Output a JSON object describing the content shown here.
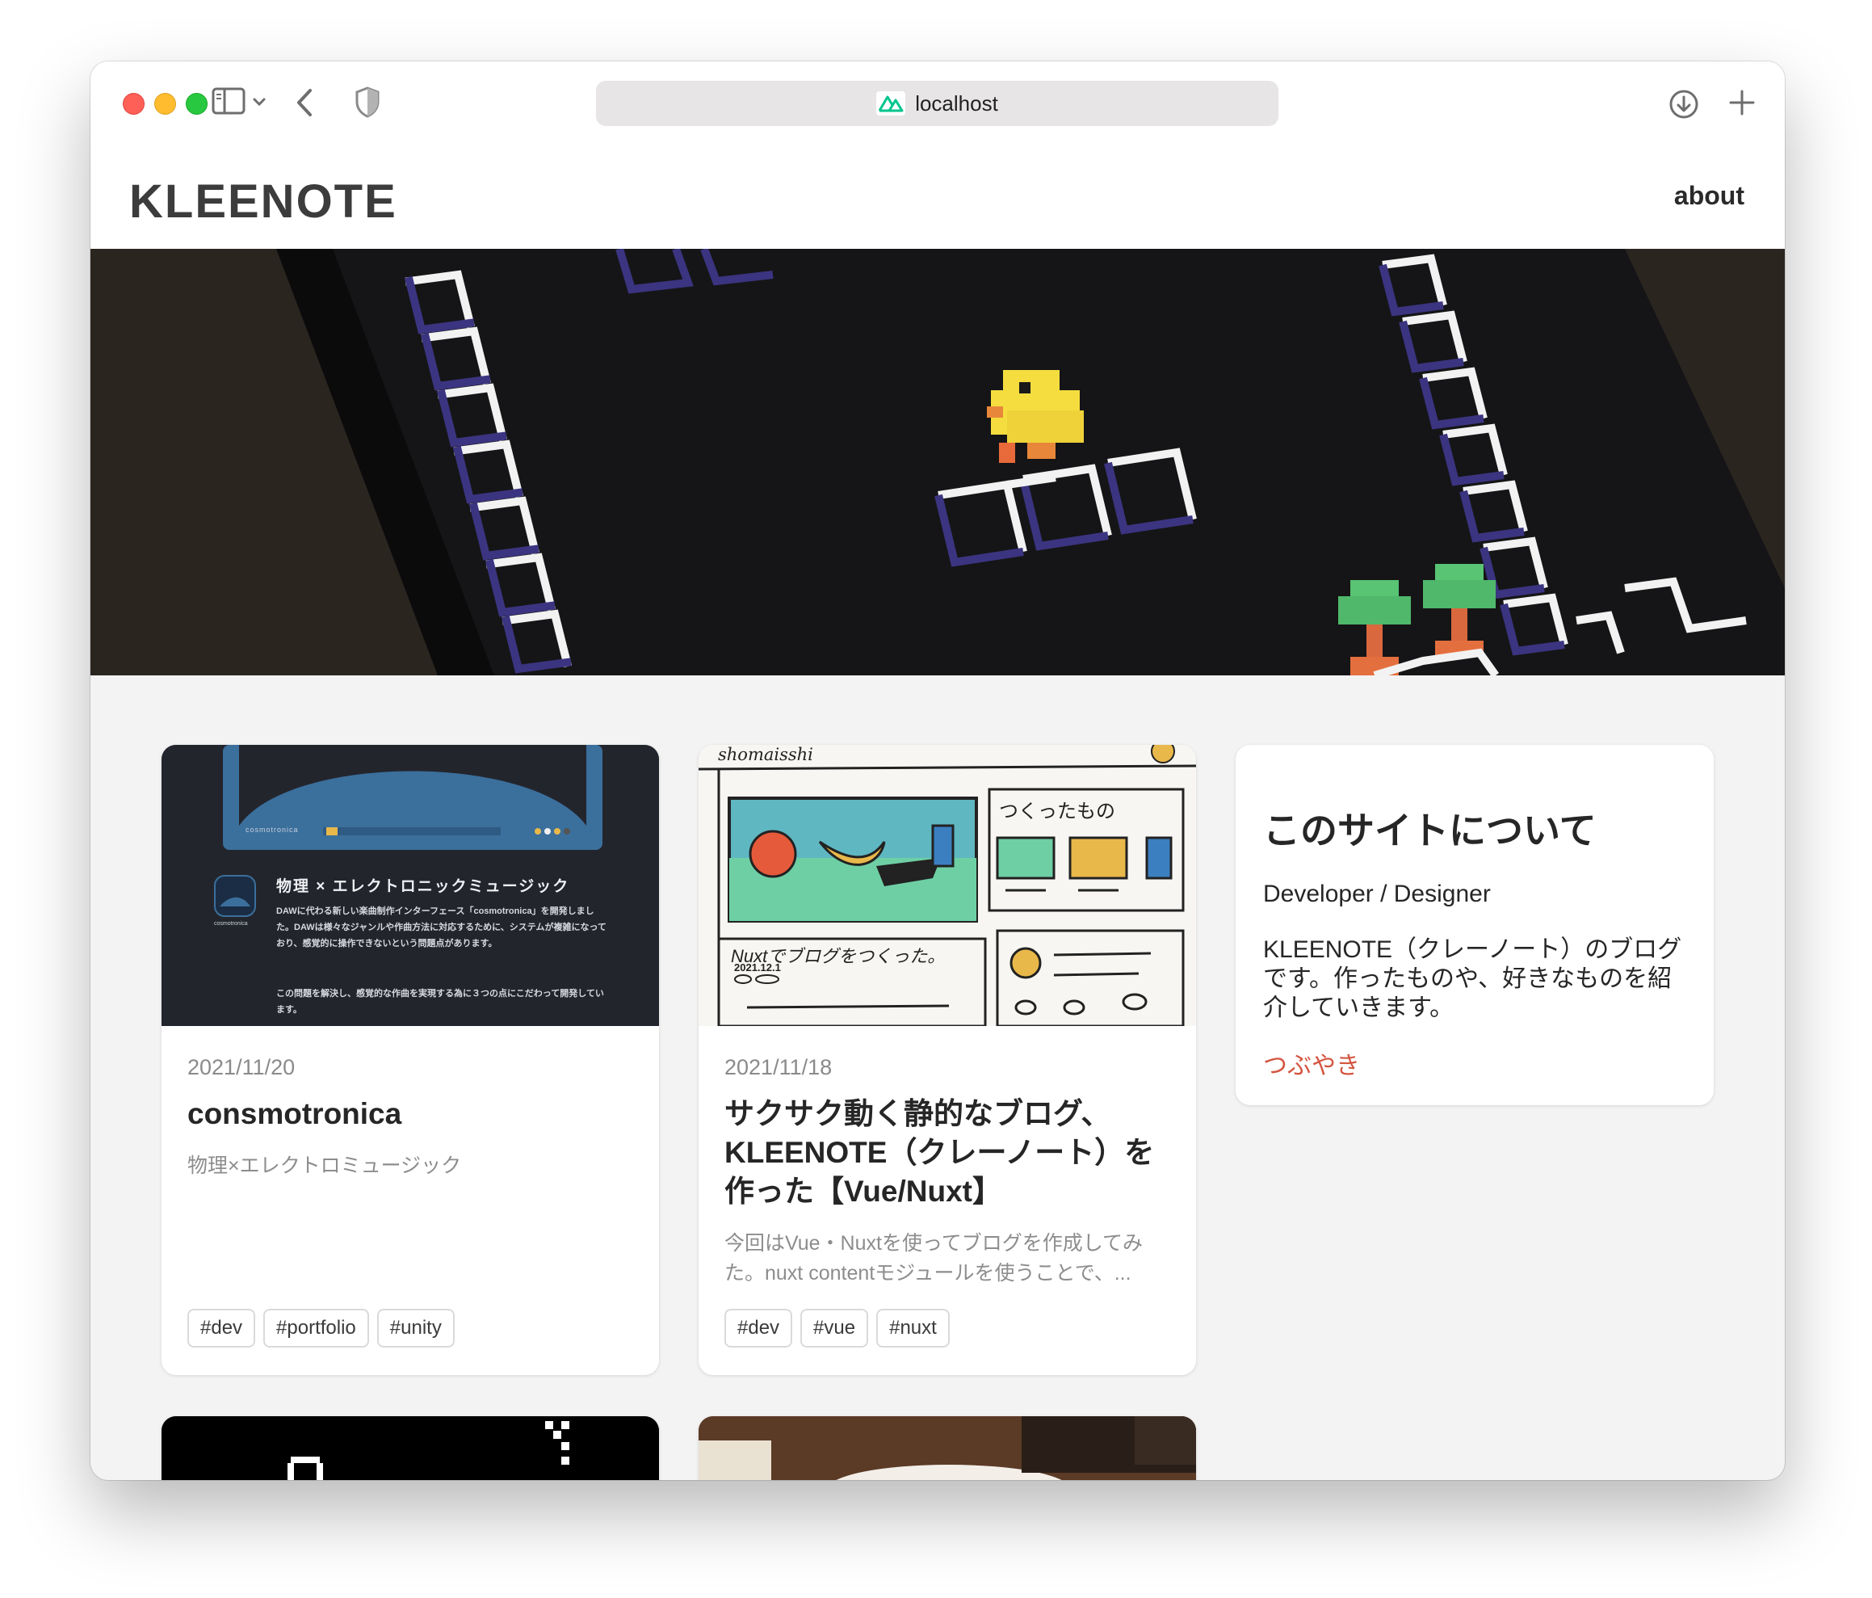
{
  "browser": {
    "url": "localhost",
    "favicon": "nuxt-logo-icon"
  },
  "site": {
    "logo": "KLEENOTE",
    "nav": {
      "about": "about"
    }
  },
  "posts": [
    {
      "date": "2021/11/20",
      "title": "consmotronica",
      "excerpt": "物理×エレクトロミュージック",
      "tags": [
        "#dev",
        "#portfolio",
        "#unity"
      ],
      "thumb": {
        "app_name": "cosmotronica",
        "heading": "物理 × エレクトロニックミュージック",
        "para1": "DAWに代わる新しい楽曲制作インターフェース「cosmotronica」を開発しました。DAWは様々なジャンルや作曲方法に対応するために、システムが複雑になっており、感覚的に操作できないという問題点があります。",
        "para2": "この問題を解決し、感覚的な作曲を実現する為に３つの点にこだわって開発しています。"
      }
    },
    {
      "date": "2021/11/18",
      "title": "サクサク動く静的なブログ、KLEENOTE（クレーノート）を作った【Vue/Nuxt】",
      "excerpt": "今回はVue・Nuxtを使ってブログを作成してみた。nuxt contentモジュールを使うことで、...",
      "tags": [
        "#dev",
        "#vue",
        "#nuxt"
      ],
      "thumb": {
        "author": "shomaisshi",
        "label1": "つくったもの",
        "label2": "Nuxtでブログをつくった。",
        "label3": "2021.12.1"
      }
    }
  ],
  "about": {
    "title": "このサイトについて",
    "role": "Developer / Designer",
    "description": "KLEENOTE（クレーノート）のブログです。作ったものや、好きなものを紹介していきます。",
    "link": "つぶやき"
  },
  "colors": {
    "accent_link": "#d4543f",
    "background": "#f3f3f3"
  }
}
